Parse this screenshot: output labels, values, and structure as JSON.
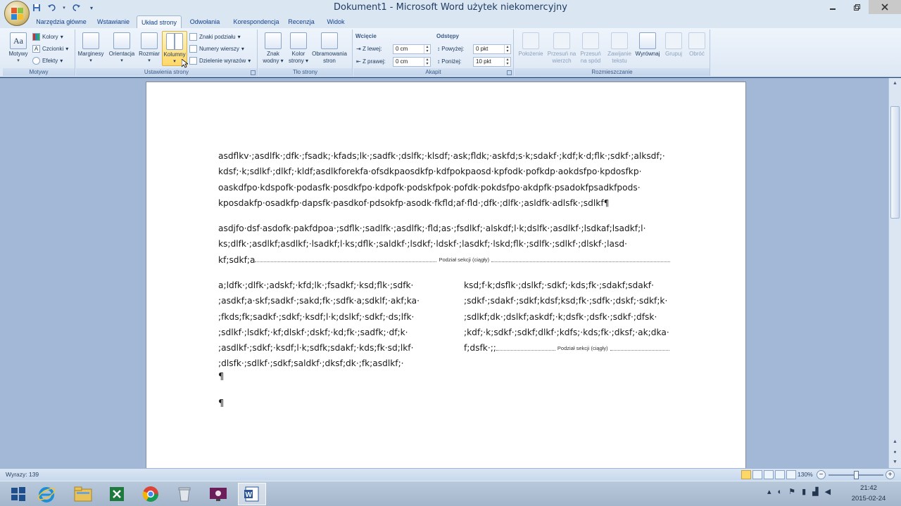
{
  "window": {
    "title": "Dokument1 - Microsoft Word użytek niekomercyjny",
    "minimize_icon": "minimize-icon",
    "maximize_icon": "maximize-icon",
    "close_icon": "close-icon"
  },
  "quick_access": {
    "save_icon": "save-icon",
    "undo_icon": "undo-icon",
    "redo_icon": "redo-icon",
    "customize_icon": "chevron-down-icon"
  },
  "tabs": [
    "Narzędzia główne",
    "Wstawianie",
    "Układ strony",
    "Odwołania",
    "Korespondencja",
    "Recenzja",
    "Widok"
  ],
  "active_tab": "Układ strony",
  "ribbon": {
    "motywy": {
      "label": "Motywy",
      "themes_button": "Motywy",
      "colors": "Kolory",
      "fonts": "Czcionki",
      "effects": "Efekty"
    },
    "ustawienia_strony": {
      "label": "Ustawienia strony",
      "margins": "Marginesy",
      "orientation": "Orientacja",
      "size": "Rozmiar",
      "columns": "Kolumny",
      "breaks": "Znaki podziału",
      "line_numbers": "Numery wierszy",
      "hyphenation": "Dzielenie wyrazów"
    },
    "tlo_strony": {
      "label": "Tło strony",
      "watermark_line1": "Znak",
      "watermark_line2": "wodny",
      "page_color_line1": "Kolor",
      "page_color_line2": "strony",
      "page_borders_line1": "Obramowania",
      "page_borders_line2": "stron"
    },
    "akapit": {
      "label": "Akapit",
      "indent_title": "Wcięcie",
      "left_label": "Z lewej:",
      "left_value": "0 cm",
      "right_label": "Z prawej:",
      "right_value": "0 cm",
      "spacing_title": "Odstępy",
      "before_label": "Powyżej:",
      "before_value": "0 pkt",
      "after_label": "Poniżej:",
      "after_value": "10 pkt"
    },
    "rozmieszczanie": {
      "label": "Rozmieszczanie",
      "position": "Położenie",
      "bring_front_line1": "Przesuń na",
      "bring_front_line2": "wierzch",
      "send_back_line1": "Przesuń",
      "send_back_line2": "na spód",
      "wrap_line1": "Zawijanie",
      "wrap_line2": "tekstu",
      "align": "Wyrównaj",
      "group": "Grupuj",
      "rotate": "Obróć"
    }
  },
  "document": {
    "para1": [
      "asdflkv·;asdlfk·;dfk·;fsadk;·kfads;lk·;sadfk·;dslfk;·klsdf;·ask;fldk;·askfd;s·k;sdakf·;kdf;k·d;flk·;sdkf·;alksdf;·",
      "kdsf;·k;sdlkf·;dlkf;·kldf;asdlkforekfa·ofsdkpaosdkfp·kdfpokpaosd·kpfodk·pofkdp·aokdsfpo·kpdosfkp·",
      "oaskdfpo·kdspofk·podasfk·posdkfpo·kdpofk·podskfpok·pofdk·pokdsfpo·akdpfk·psadokfpsadkfpods·",
      "kposdakfp·osadkfp·dapsfk·pasdkof·pdsokfp·asodk·fkfld;af·fld·;dfk·;dlfk·;asldfk·adlsfk·;sdlkf¶"
    ],
    "para2": [
      "asdjfo·dsf·asdofk·pakfdpoa·;sdflk·;sadlfk·;asdlfk;·fld;as·;fsdlkf;·alskdf;l·k;dslfk·;asdlkf·;lsdkaf;lsadkf;l·",
      "ks;dlfk·;asdlkf;asdlkf;·lsadkf;l·ks;dflk·;saldkf·;lsdkf;·ldskf·;lasdkf;·lskd;flk·;sdlfk·;sdlkf·;dlskf·;lasd·"
    ],
    "para2_last": "kf;sdkf;a",
    "section_break_label": "Podział sekcji (ciągły)",
    "col1": [
      "a;ldfk·;dlfk·;adskf;·kfd;lk·;fsadkf;·ksd;flk·;sdfk·",
      ";asdkf;a·skf;sadkf·;sakd;fk·;sdfk·a;sdklf;·akf;ka·",
      ";fkds;fk;sadkf·;sdkf;·ksdf;l·k;dslkf;·sdkf;·ds;lfk·",
      ";sdlkf·;lsdkf;·kf;dlskf·;dskf;·kd;fk·;sadfk;·df;k·",
      ";asdlkf·;sdkf;·ksdf;l·k;sdfk;sdakf;·kds;fk·sd;lkf·",
      ";dlsfk·;sdlkf·;sdkf;saldkf·;dksf;dk·;fk;asdlkf;·"
    ],
    "col2": [
      "ksd;f·k;dsflk·;dslkf;·sdkf;·kds;fk·;sdakf;sdakf·",
      ";sdkf·;sdakf·;sdkf;kdsf;ksd;fk·;sdfk·;dskf;·sdkf;k·",
      ";sdlkf;dk·;dslkf;askdf;·k;dsfk·;dsfk·;sdkf·;dfsk·",
      ";kdf;·k;sdkf·;sdkf;dlkf·;kdfs;·kds;fk·;dksf;·ak;dka·"
    ],
    "col2_last": "f;dsfk·;;",
    "pilcrow": "¶"
  },
  "status": {
    "word_count": "Wyrazy: 139",
    "zoom": "130%",
    "zoom_minus": "−",
    "zoom_plus": "+"
  },
  "taskbar": {
    "items": [
      "start-icon",
      "ie-icon",
      "explorer-icon",
      "excel-icon",
      "chrome-icon",
      "recycle-icon",
      "video-icon",
      "word-icon"
    ],
    "time": "21:42",
    "date": "2015-02-24"
  }
}
